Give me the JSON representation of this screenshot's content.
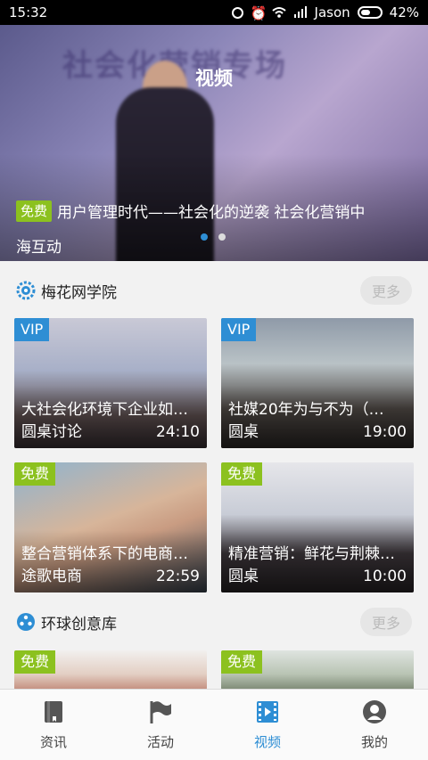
{
  "status_bar": {
    "time": "15:32",
    "carrier": "Jason",
    "battery": "42%"
  },
  "hero": {
    "title": "视频",
    "badge": "免费",
    "caption": "用户管理时代——社会化的逆袭 社会化营销中海互动",
    "banner_text": "社会化营销专场",
    "slides": 2,
    "active_slide": 1
  },
  "sections": [
    {
      "title": "梅花网学院",
      "more_label": "更多",
      "icon": "gear-logo-icon",
      "cards": [
        {
          "tag": "VIP",
          "tag_type": "vip",
          "title": "大社会化环境下企业如…",
          "author": "圆桌讨论",
          "duration": "24:10"
        },
        {
          "tag": "VIP",
          "tag_type": "vip",
          "title": "社媒20年为与不为（…",
          "author": "圆桌",
          "duration": "19:00"
        },
        {
          "tag": "免费",
          "tag_type": "free",
          "title": "整合营销体系下的电商…",
          "author": "途歌电商",
          "duration": "22:59"
        },
        {
          "tag": "免费",
          "tag_type": "free",
          "title": "精准营销：鲜花与荆棘…",
          "author": "圆桌",
          "duration": "10:00"
        }
      ]
    },
    {
      "title": "环球创意库",
      "more_label": "更多",
      "icon": "film-reel-icon",
      "cards": [
        {
          "tag": "免费",
          "tag_type": "free"
        },
        {
          "tag": "免费",
          "tag_type": "free"
        }
      ]
    }
  ],
  "tabs": [
    {
      "label": "资讯",
      "icon": "book-icon",
      "active": false
    },
    {
      "label": "活动",
      "icon": "flag-icon",
      "active": false
    },
    {
      "label": "视频",
      "icon": "film-icon",
      "active": true
    },
    {
      "label": "我的",
      "icon": "user-icon",
      "active": false
    }
  ],
  "colors": {
    "accent": "#2e8ed4",
    "free": "#8cc11f",
    "vip": "#2e8ed4"
  }
}
